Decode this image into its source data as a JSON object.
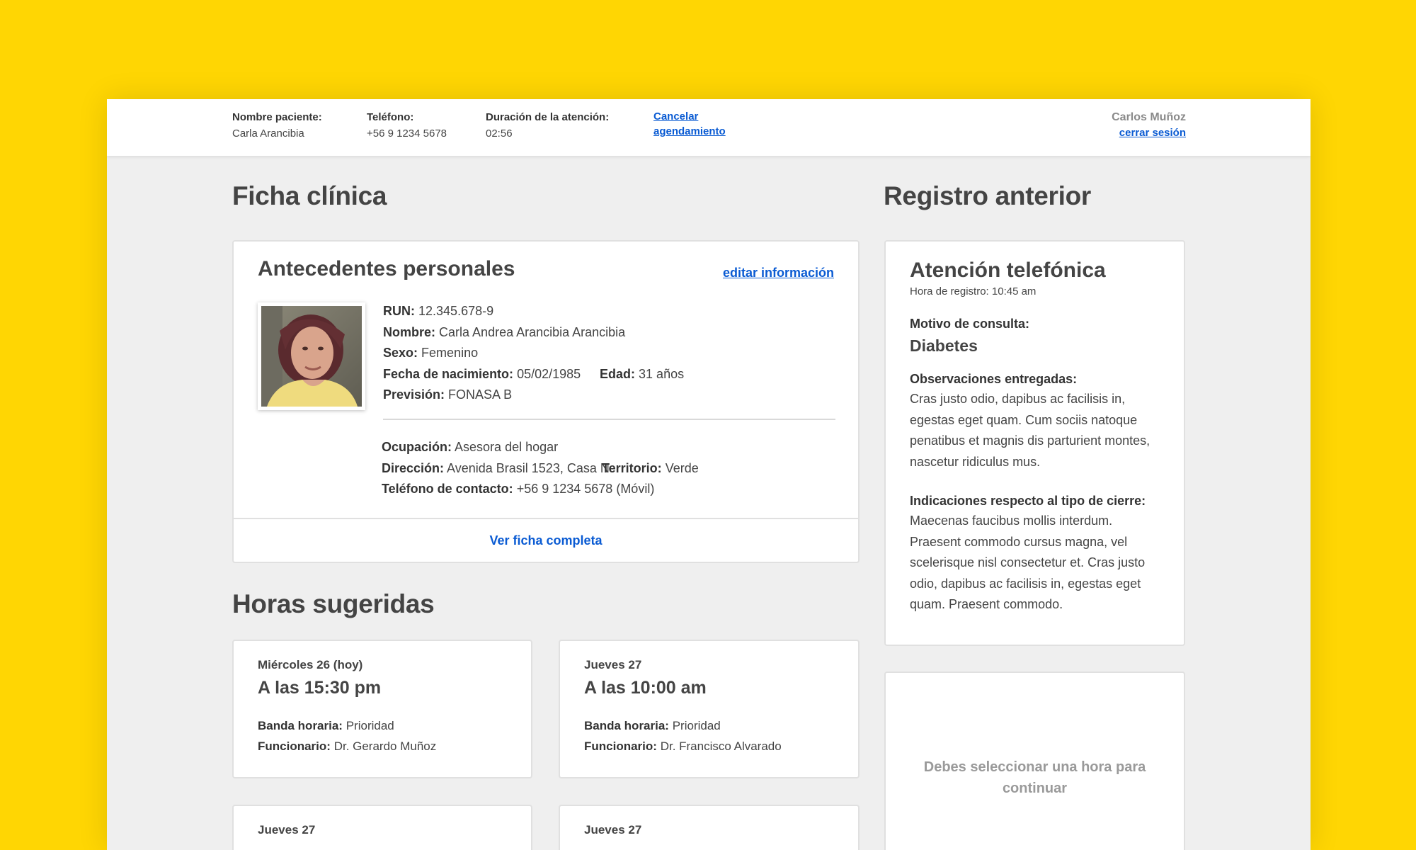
{
  "topbar": {
    "patient_label": "Nombre paciente:",
    "patient_value": "Carla Arancibia",
    "phone_label": "Teléfono:",
    "phone_value": "+56 9 1234 5678",
    "duration_label": "Duración de la atención:",
    "duration_value": "02:56",
    "cancel_line1": "Cancelar",
    "cancel_line2": "agendamiento",
    "user_name": "Carlos Muñoz",
    "logout_label": "cerrar sesión"
  },
  "clinical": {
    "section_title": "Ficha clínica",
    "card_title": "Antecedentes personales",
    "edit_label": "editar información",
    "run_label": "RUN:",
    "run_value": "12.345.678-9",
    "name_label": "Nombre:",
    "name_value": "Carla Andrea Arancibia Arancibia",
    "sex_label": "Sexo:",
    "sex_value": "Femenino",
    "dob_label": "Fecha de nacimiento:",
    "dob_value": "05/02/1985",
    "age_label": "Edad:",
    "age_value": "31 años",
    "insurance_label": "Previsión:",
    "insurance_value": "FONASA B",
    "occupation_label": "Ocupación:",
    "occupation_value": "Asesora del hogar",
    "address_label": "Dirección:",
    "address_value": "Avenida Brasil 1523, Casa N",
    "territory_label": "Territorio:",
    "territory_value": "Verde",
    "contact_label": "Teléfono de contacto:",
    "contact_value": "+56 9 1234 5678 (Móvil)",
    "view_full_label": "Ver ficha completa"
  },
  "suggested": {
    "section_title": "Horas sugeridas",
    "band_label": "Banda horaria:",
    "staff_label": "Funcionario:",
    "slots": [
      {
        "day": "Miércoles 26 (hoy)",
        "time": "A las 15:30 pm",
        "band": "Prioridad",
        "staff": "Dr. Gerardo Muñoz"
      },
      {
        "day": "Jueves 27",
        "time": "A las 10:00 am",
        "band": "Prioridad",
        "staff": "Dr. Francisco Alvarado"
      },
      {
        "day": "Jueves 27"
      },
      {
        "day": "Jueves 27"
      }
    ]
  },
  "previous": {
    "section_title": "Registro anterior",
    "card_title": "Atención telefónica",
    "time_text": "Hora de registro: 10:45 am",
    "reason_label": "Motivo de consulta:",
    "reason_value": "Diabetes",
    "observations_label": "Observaciones entregadas:",
    "observations_text": "Cras justo odio, dapibus ac facilisis in, egestas eget quam. Cum sociis natoque penatibus et magnis dis parturient montes, nascetur ridiculus mus.",
    "closing_label": "Indicaciones respecto al tipo de cierre:",
    "closing_text": "Maecenas faucibus mollis interdum. Praesent commodo cursus magna, vel scelerisque nisl consectetur et. Cras justo odio, dapibus ac facilisis in, egestas eget quam. Praesent commodo."
  },
  "selection_prompt": "Debes seleccionar una hora para continuar",
  "colors": {
    "background": "#FFD603",
    "link": "#0a5bd3",
    "panel": "#efefef"
  }
}
